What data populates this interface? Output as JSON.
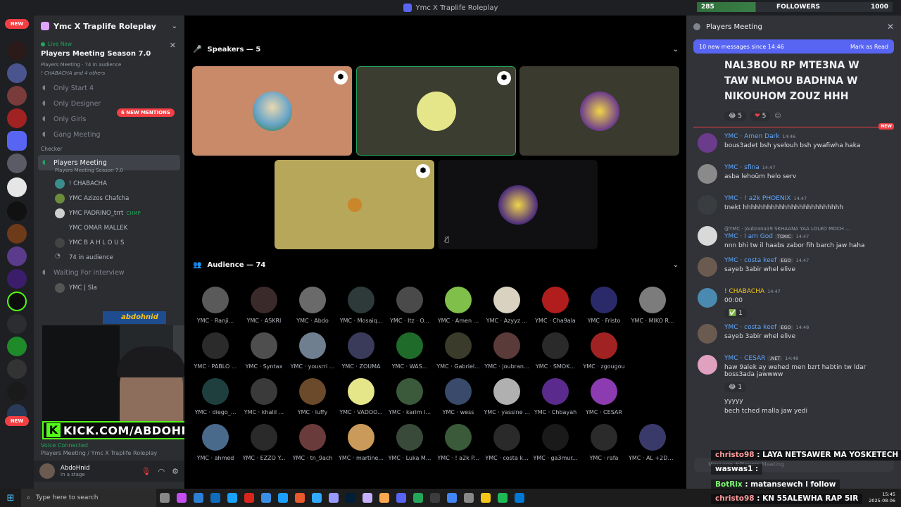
{
  "window": {
    "title": "Ymc X Traplife Roleplay"
  },
  "rail": {
    "new_top": "NEW",
    "new_bottom": "NEW"
  },
  "sidebar": {
    "server_name": "Ymc X Traplife Roleplay",
    "live_label": "Live Now",
    "live_title": "Players Meeting Season 7.0",
    "live_meta": "Players Meeting · 74 in audience",
    "live_meta2": "! CHABACHA and 4 others",
    "new_mentions": "6 NEW MENTIONS",
    "channels": [
      "Only Start 4",
      "Only Designer",
      "Only Girls",
      "Gang Meeting"
    ],
    "category": "Checker",
    "active_channel": "Players Meeting",
    "active_sub": "Players Meeting Season 7.0",
    "members": [
      {
        "name": "! CHABACHA",
        "tag": ""
      },
      {
        "name": "YMC Azizos Chafcha",
        "tag": ""
      },
      {
        "name": "YMC PADRINO_trrt",
        "tag": "CHMP"
      },
      {
        "name": "YMC OMAR MALLEK",
        "tag": ""
      },
      {
        "name": "YMC B A H L O U S",
        "tag": ""
      }
    ],
    "audience_count": "74 in audience",
    "waiting": "Waiting For interview",
    "waiting_member": "YMC | Sla"
  },
  "overlay": {
    "abdo_tag": "abdohnid",
    "kick_url": "KICK.COM/ABDOHNID"
  },
  "voice": {
    "status": "Voice Connected",
    "location": "Players Meeting / Ymc X Traplife Roleplay"
  },
  "user": {
    "name": "AbdoHnid",
    "status": "In a stage"
  },
  "stage": {
    "speakers_header": "Speakers — 5",
    "audience_header": "Audience — 74",
    "audience": [
      "YMC · Ranji...",
      "YMC · ASKRI",
      "YMC · Abdo",
      "YMC · Mosaiq...",
      "YMC · Itz · O...",
      "YMC · Amen ...",
      "YMC · Azyyz ...",
      "YMC · Cha9ala",
      "YMC · Fristo",
      "YMC · MIKO R...",
      "YMC · PABLO ...",
      "YMC · Syntax",
      "YMC · yousrri ...",
      "YMC · ZOUMA",
      "YMC · WAS...",
      "YMC · Gabriel...",
      "YMC · joubran...",
      "YMC · SMOK...",
      "YMC · zgougou",
      "YMC · diego_...",
      "YMC · khalil ...",
      "YMC · luffy",
      "YMC · VADOO...",
      "YMC · karim l...",
      "YMC · wess",
      "YMC · yassine ...",
      "YMC · Chbayah",
      "YMC · CESAR",
      "YMC · ahmed",
      "YMC · EZZO Y...",
      "YMC · tn_9ach",
      "YMC · martine...",
      "YMC · Luka M...",
      "YMC · ! a2k P...",
      "YMC · costa k...",
      "YMC · ga3mur...",
      "YMC · rafa",
      "YMC · AL +2D1..."
    ]
  },
  "chat": {
    "followers_count": "285",
    "followers_label": "FOLLOWERS",
    "followers_goal": "1000",
    "channel": "Players Meeting",
    "new_messages": "10 new messages since 14:46",
    "mark_read": "Mark as Read",
    "big_text": "NAL3BOU RP MTE3NA W TAW NLMOU BADHNA W NIKOUHOM ZOUZ HHH",
    "reactions": [
      {
        "emoji": "😂",
        "count": "5"
      },
      {
        "emoji": "❤",
        "count": "5"
      }
    ],
    "new_badge": "NEW",
    "messages": [
      {
        "author": "YMC · Amen Dark",
        "time": "14:46",
        "role": "",
        "reply": "",
        "text": "bous3adet bsh yselouh bsh ywafiwha haka"
      },
      {
        "author": "YMC · sfina",
        "time": "14:47",
        "role": "",
        "reply": "",
        "text": "asba lehoüm helo serv"
      },
      {
        "author": "YMC · ! a2k PHOENIX",
        "time": "14:47",
        "role": "",
        "reply": "",
        "text": "tnekt hhhhhhhhhhhhhhhhhhhhhhhhh"
      },
      {
        "author": "YMC · I am God",
        "time": "14:47",
        "role": "TOXIC",
        "reply": "@YMC · joubrana19 SKHAANA YAA LOLED MOCH ...",
        "text": "nnn bhi tw il haabs zabor fih barch jaw haha"
      },
      {
        "author": "YMC · costa keef",
        "time": "14:47",
        "role": "EGO",
        "reply": "",
        "text": "sayeb 3abir whel elive"
      },
      {
        "author": "! CHABACHA",
        "time": "14:47",
        "role": "",
        "reply": "",
        "text": "00:00"
      },
      {
        "author": "YMC · costa keef",
        "time": "14:48",
        "role": "EGO",
        "reply": "",
        "text": "sayeb 3abir whel elive"
      },
      {
        "author": "YMC · CESAR",
        "time": "14:48",
        "role": ".NET",
        "reply": "",
        "text": "haw 9alek ay wehed men bzrt habtin tw ldar boss3ada jawwww"
      }
    ],
    "check_count": "1",
    "laugh_count": "1",
    "tail_text_1": "yyyyy",
    "tail_text_2": "bech tched malla jaw yedi",
    "input_placeholder": "Message #Players Meeting"
  },
  "stream_chat": [
    {
      "user": "christo98",
      "text": "LAYA NETSAWER MA YOSKETECH"
    },
    {
      "user": "waswas1",
      "text": ":"
    },
    {
      "user": "BotRix",
      "text": "matansewch l follow"
    },
    {
      "user": "christo98",
      "text": "KN 55ALEWHA RAP 5IR"
    }
  ],
  "taskbar": {
    "search_placeholder": "Type here to search",
    "time": "15:45",
    "date": "2025-08-06"
  },
  "colors": {
    "accent": "#5865f2",
    "live_green": "#23a55a",
    "danger": "#f23f43",
    "kick_green": "#53fc18"
  }
}
